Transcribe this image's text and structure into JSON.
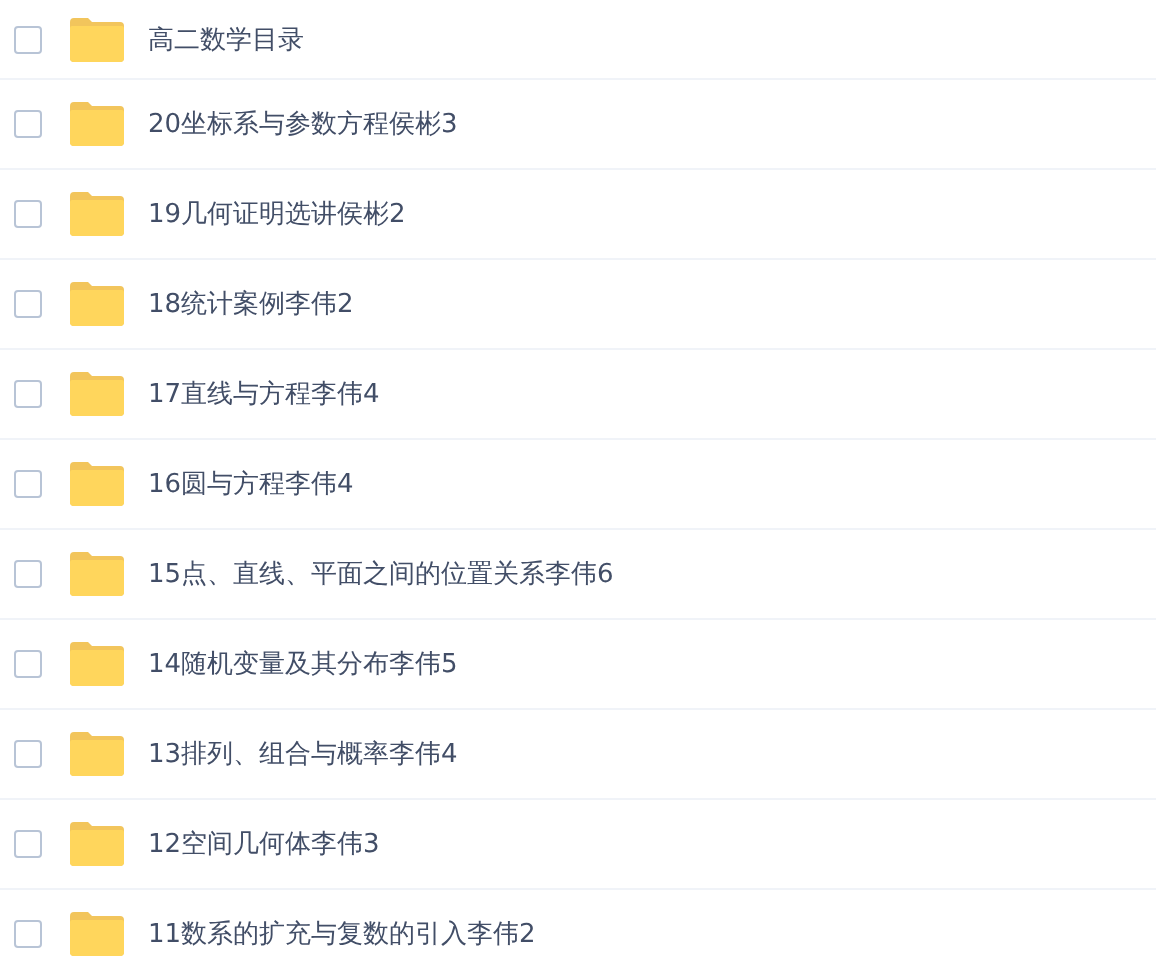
{
  "files": [
    {
      "name": "高二数学目录",
      "checked": false
    },
    {
      "name": "20坐标系与参数方程侯彬3",
      "checked": false
    },
    {
      "name": "19几何证明选讲侯彬2",
      "checked": false
    },
    {
      "name": "18统计案例李伟2",
      "checked": false
    },
    {
      "name": "17直线与方程李伟4",
      "checked": false
    },
    {
      "name": "16圆与方程李伟4",
      "checked": false
    },
    {
      "name": "15点、直线、平面之间的位置关系李伟6",
      "checked": false
    },
    {
      "name": "14随机变量及其分布李伟5",
      "checked": false
    },
    {
      "name": "13排列、组合与概率李伟4",
      "checked": false
    },
    {
      "name": "12空间几何体李伟3",
      "checked": false
    },
    {
      "name": "11数系的扩充与复数的引入李伟2",
      "checked": false
    }
  ]
}
